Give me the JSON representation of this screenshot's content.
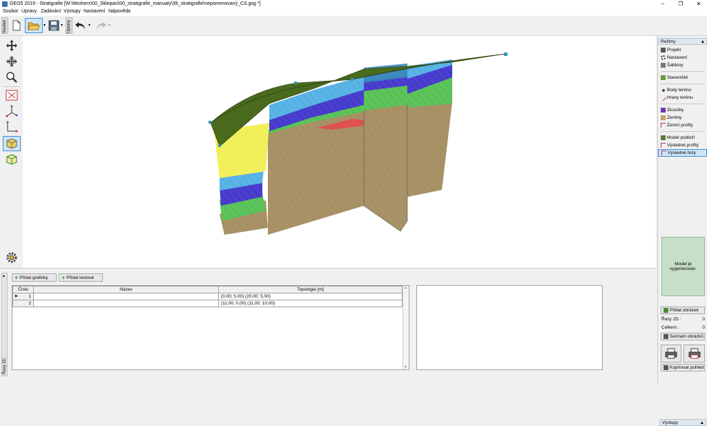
{
  "window": {
    "title": "GEO5 2019 - Stratigrafie [W:\\Workers\\00_Sklepaci\\00_stratigrafie_manualy\\39_stratigrafie\\nepomenovaný_CS.gsg *]",
    "minimize": "–",
    "maximize": "❐",
    "close": "✕"
  },
  "menu": [
    "Soubor",
    "Úpravy",
    "Zadávání",
    "Výstupy",
    "Nastavení",
    "Nápověda"
  ],
  "toolbar": {
    "tab_file": "Soubor",
    "tab_edit": "Úpravy"
  },
  "modes": {
    "header": "Režimy",
    "items": [
      "Projekt",
      "Nastavení",
      "Šablony",
      "Staveniště",
      "Body terénu",
      "Hrany terénu",
      "Zkoušky",
      "Zeminy",
      "Zemní profily",
      "Model podloží",
      "Výsledné profily",
      "Výsledné řezy"
    ]
  },
  "status": {
    "message": "Model je vygenerován."
  },
  "outputs": {
    "header": "Výstupy",
    "add_picture": "Přidat obrázek",
    "sections_2d_label": "Řezy 2D :",
    "sections_2d_value": "0",
    "total_label": "Celkem :",
    "total_value": "0",
    "picture_list": "Seznam obrázků",
    "copy_view": "Kopírovat pohled"
  },
  "bottom": {
    "side_tab": "Řezy 2D",
    "add_graphic": "Přidat graficky",
    "add_text": "Přidat textově",
    "table": {
      "headers": [
        "Číslo",
        "Název",
        "Topologie [m]"
      ],
      "rows": [
        {
          "num": "1",
          "name": "",
          "topology": "(0,00; 5,00) (20,00; 5,00)"
        },
        {
          "num": "2",
          "name": "",
          "topology": "(11,00; 0,00) (11,00; 10,00)"
        }
      ]
    }
  },
  "colors": {
    "accent": "#3c8fd6",
    "status_bg": "#c6dfc6",
    "terrain": "#4a6a1e",
    "soil_brown": "#a89266",
    "clay_yellow": "#f2f05a",
    "sky_blue": "#5ab4e6",
    "violet": "#4a3fd0",
    "green": "#5cc45a",
    "red": "#e05050"
  }
}
